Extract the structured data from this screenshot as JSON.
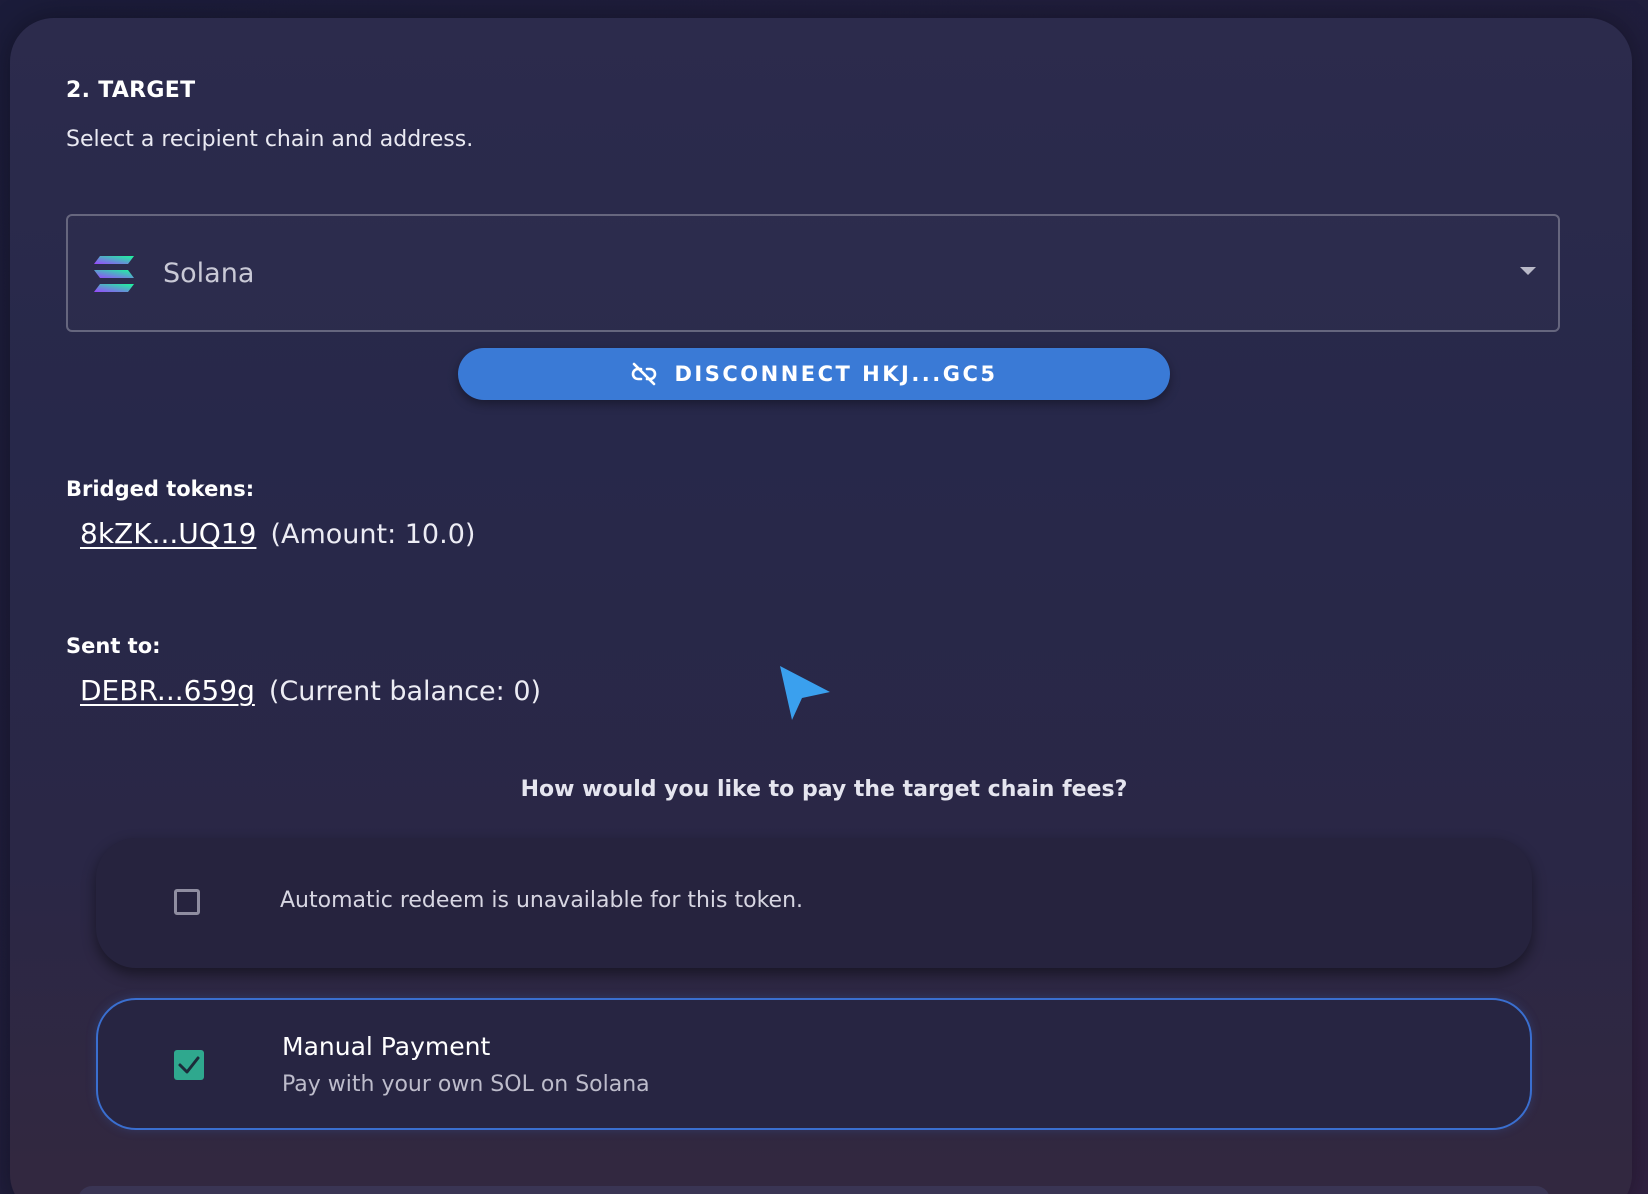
{
  "step": {
    "title": "2. TARGET",
    "subtitle": "Select a recipient chain and address."
  },
  "chain_select": {
    "selected": "Solana",
    "icon": "solana-logo-icon"
  },
  "wallet": {
    "disconnect_label": "DISCONNECT HKJ...GC5",
    "icon": "link-off-icon"
  },
  "bridged_tokens": {
    "label": "Bridged tokens:",
    "address": "8kZK...UQ19",
    "detail": "(Amount: 10.0)"
  },
  "sent_to": {
    "label": "Sent to:",
    "address": "DEBR...659g",
    "detail": "(Current balance: 0)"
  },
  "fees": {
    "question": "How would you like to pay the target chain fees?",
    "options": [
      {
        "text": "Automatic redeem is unavailable for this token.",
        "checked": false
      },
      {
        "title": "Manual Payment",
        "subtitle": "Pay with your own SOL on Solana",
        "checked": true
      }
    ]
  },
  "colors": {
    "accent": "#3a7ad6",
    "checkbox_checked": "#2fa88e",
    "selected_border": "#3a6fd0"
  }
}
